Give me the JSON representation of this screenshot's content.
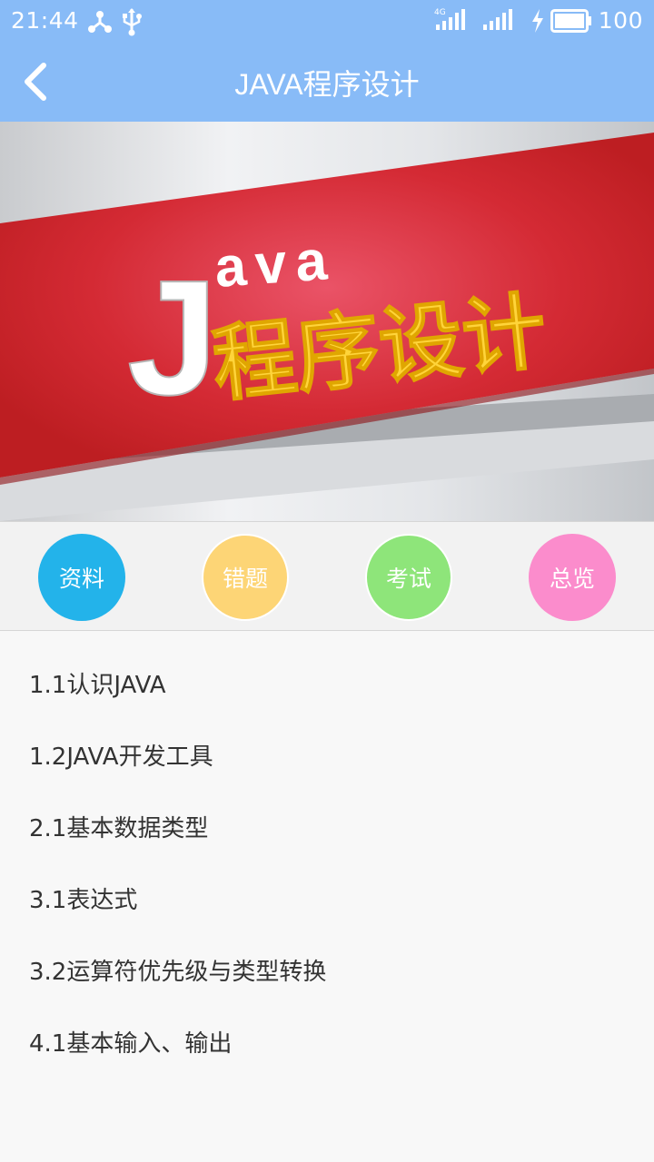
{
  "status_bar": {
    "time": "21:44",
    "network_label": "4G",
    "battery": "100",
    "icons": [
      "share-icon",
      "usb-icon",
      "signal-4g-icon",
      "signal-icon",
      "charging-icon",
      "battery-icon"
    ]
  },
  "header": {
    "title": "JAVA程序设计",
    "back_icon": "chevron-left-icon",
    "background": "#88bbf7"
  },
  "banner": {
    "letter_big": "J",
    "letters_small": "ava",
    "chinese": "程序设计",
    "band_color": "#d42a34",
    "text_color": "#ffd43a"
  },
  "quick_actions": [
    {
      "label": "资料",
      "color": "#23b3ea"
    },
    {
      "label": "错题",
      "color": "#fdd576"
    },
    {
      "label": "考试",
      "color": "#8ee57a"
    },
    {
      "label": "总览",
      "color": "#fb8ccc"
    }
  ],
  "chapters": [
    "1.1认识JAVA",
    "1.2JAVA开发工具",
    "2.1基本数据类型",
    "3.1表达式",
    "3.2运算符优先级与类型转换",
    "4.1基本输入、输出"
  ]
}
